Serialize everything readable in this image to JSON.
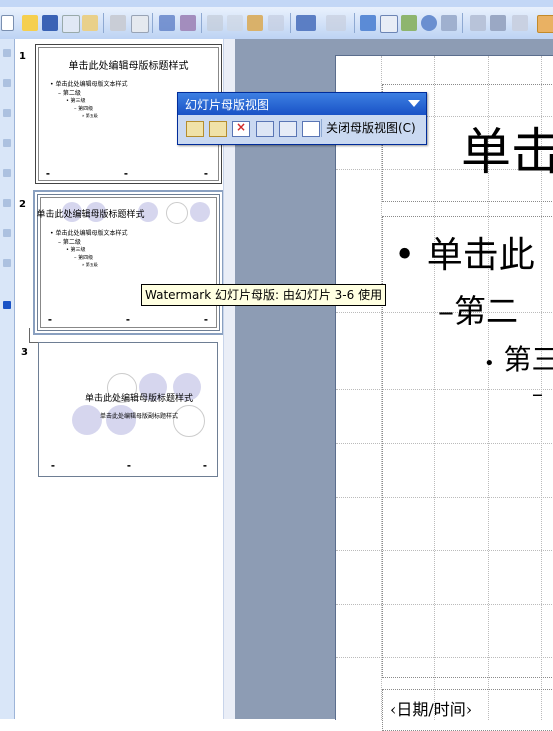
{
  "toolbar": {
    "icons": [
      "new-icon",
      "open-icon",
      "save-icon",
      "permission-icon",
      "email-icon",
      "print-icon",
      "print-preview-icon",
      "spelling-icon",
      "research-icon",
      "cut-icon",
      "copy-icon",
      "paste-icon",
      "format-painter-icon",
      "undo-icon",
      "redo-icon",
      "insert-chart-icon",
      "insert-table-icon",
      "tables-borders-icon",
      "insert-hyperlink-icon",
      "expand-icon",
      "show-formatting-icon",
      "grid-icon"
    ]
  },
  "slides": [
    {
      "number": "1",
      "title": "单击此处编辑母版标题样式",
      "bullets": [
        "单击此处编辑母版文本样式",
        "第二级",
        "第三级",
        "第四级",
        "第五级"
      ]
    },
    {
      "number": "2",
      "title": "单击此处编辑母版标题样式",
      "bullets": [
        "单击此处编辑母版文本样式",
        "第二级",
        "第三级",
        "第四级",
        "第五级"
      ]
    },
    {
      "number": "3",
      "title": "单击此处编辑母版标题样式",
      "subtitle": "单击此处编辑母版副标题样式"
    }
  ],
  "tooltip": "Watermark 幻灯片母版: 由幻灯片 3-6 使用",
  "master_toolbar": {
    "title": "幻灯片母版视图",
    "close_label": "关闭母版视图(C)",
    "icons": [
      "insert-new-slide-master-icon",
      "insert-new-title-master-icon",
      "delete-master-icon",
      "preserve-master-icon",
      "rename-master-icon",
      "master-layout-icon"
    ]
  },
  "editor": {
    "title_fragment": "单击",
    "bullet1": "单击此",
    "bullet2": "第二",
    "bullet3": "第三",
    "bullet4": "–",
    "date_placeholder": "‹日期/时间›"
  },
  "colors": {
    "accent": "#1952c6",
    "circle_fill": "#d6d6ee",
    "workspace": "#8d9cb4"
  }
}
